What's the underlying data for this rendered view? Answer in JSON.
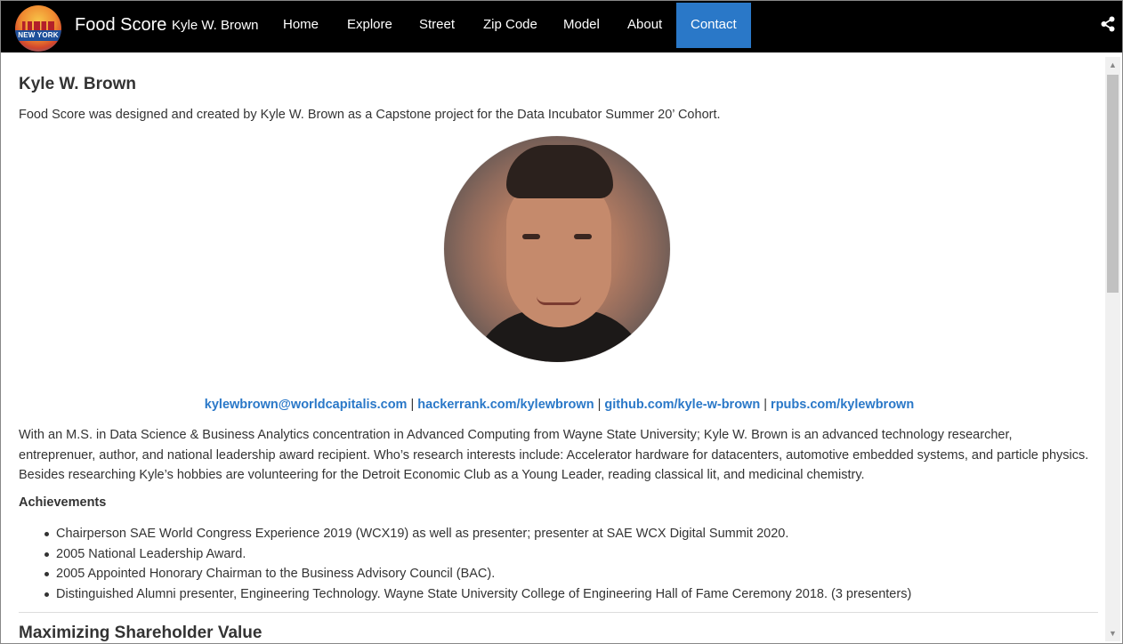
{
  "navbar": {
    "logo_text": "NEW YORK",
    "brand": "Food Score",
    "author": "Kyle W. Brown",
    "items": [
      {
        "label": "Home"
      },
      {
        "label": "Explore"
      },
      {
        "label": "Street"
      },
      {
        "label": "Zip Code"
      },
      {
        "label": "Model"
      },
      {
        "label": "About"
      },
      {
        "label": "Contact",
        "active": true
      }
    ],
    "accent_color": "#2a78c8",
    "share_icon": "share-icon"
  },
  "main": {
    "title": "Kyle W. Brown",
    "intro": "Food Score was designed and created by Kyle W. Brown as a Capstone project for the Data Incubator Summer 20’ Cohort.",
    "links": [
      "kylewbrown@worldcapitalis.com",
      "hackerrank.com/kylewbrown",
      "github.com/kyle-w-brown",
      "rpubs.com/kylewbrown"
    ],
    "link_separator": "|",
    "bio": "With an M.S. in Data Science & Business Analytics concentration in Advanced Computing from Wayne State University; Kyle W. Brown is an advanced technology researcher, entreprenuer, author, and national leadership award recipient. Who’s research interests include: Accelerator hardware for datacenters, automotive embedded systems, and particle physics. Besides researching Kyle’s hobbies are volunteering for the Detroit Economic Club as a Young Leader, reading classical lit, and medicinal chemistry.",
    "achievements_heading": "Achievements",
    "achievements": [
      "Chairperson SAE World Congress Experience 2019 (WCX19) as well as presenter; presenter at SAE WCX Digital Summit 2020.",
      "2005 National Leadership Award.",
      "2005 Appointed Honorary Chairman to the Business Advisory Council (BAC).",
      "Distinguished Alumni presenter, Engineering Technology. Wayne State University College of Engineering Hall of Fame Ceremony 2018. (3 presenters)"
    ],
    "next_section_heading": "Maximizing Shareholder Value"
  }
}
